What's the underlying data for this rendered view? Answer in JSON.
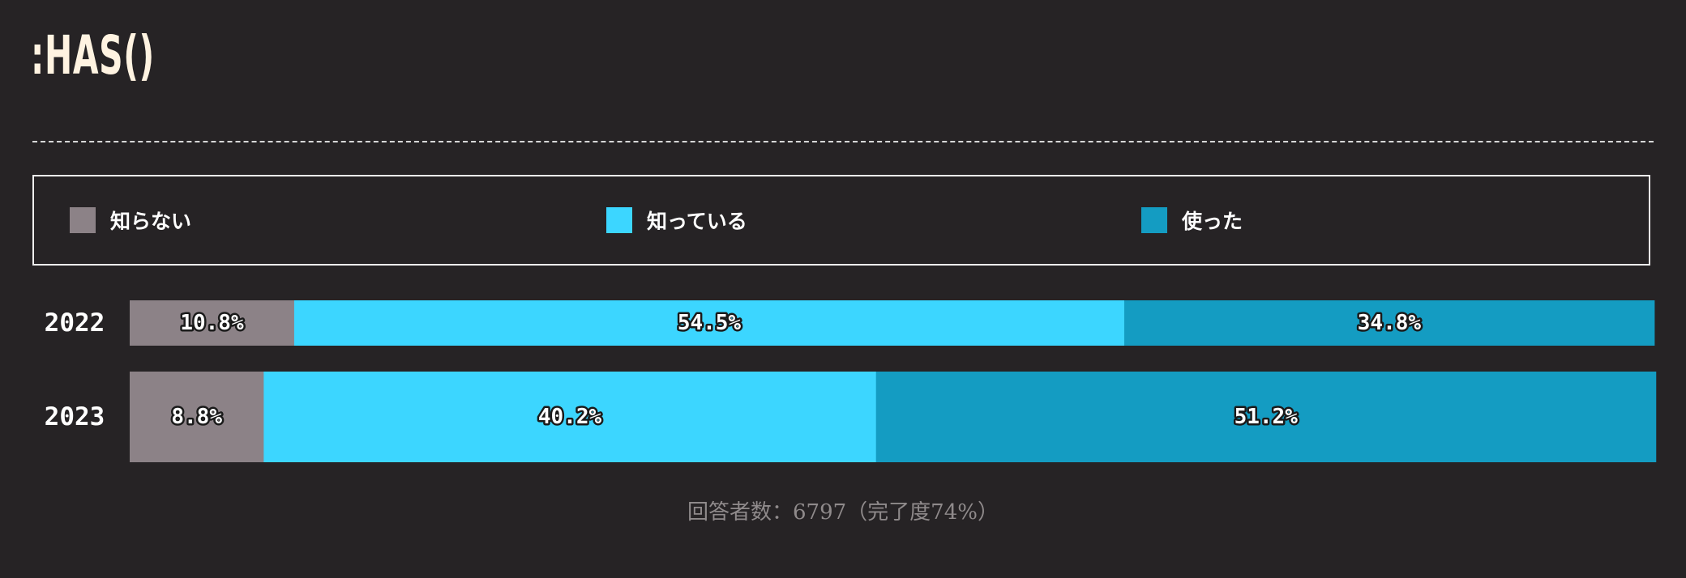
{
  "title": ":HAS()",
  "legend": [
    {
      "label": "知らない",
      "color": "#8c8287"
    },
    {
      "label": "知っている",
      "color": "#3cd6ff"
    },
    {
      "label": "使った",
      "color": "#149cc2"
    }
  ],
  "chart_data": {
    "type": "bar",
    "orientation": "horizontal",
    "stacked": true,
    "normalized": true,
    "title": ":HAS()",
    "categories": [
      "2022",
      "2023"
    ],
    "series": [
      {
        "name": "知らない",
        "values": [
          10.8,
          8.8
        ],
        "labels": [
          "10.8%",
          "8.8%"
        ],
        "color": "#8c8287"
      },
      {
        "name": "知っている",
        "values": [
          54.5,
          40.2
        ],
        "labels": [
          "54.5%",
          "40.2%"
        ],
        "color": "#3cd6ff"
      },
      {
        "name": "使った",
        "values": [
          34.8,
          51.2
        ],
        "labels": [
          "34.8%",
          "51.2%"
        ],
        "color": "#149cc2"
      }
    ],
    "xlim": [
      0,
      100
    ],
    "grid": false,
    "legend_position": "top",
    "row_weights": [
      1,
      2
    ]
  },
  "footer": "回答者数：6797（完了度74%）"
}
